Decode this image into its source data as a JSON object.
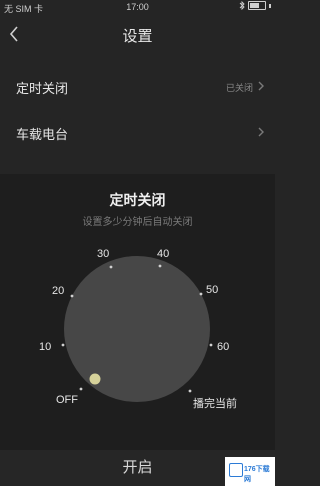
{
  "status_bar": {
    "carrier": "无 SIM 卡",
    "time": "17:00",
    "bluetooth_icon": "bluetooth-icon",
    "battery_icon": "battery-icon"
  },
  "nav": {
    "back_icon": "chevron-left-icon",
    "title": "设置"
  },
  "menu": {
    "items": [
      {
        "label": "定时关闭",
        "value": "已关闭"
      },
      {
        "label": "车载电台",
        "value": ""
      }
    ]
  },
  "sleep_timer": {
    "title": "定时关闭",
    "subtitle": "设置多少分钟后自动关闭",
    "dial_labels": [
      "OFF",
      "10",
      "20",
      "30",
      "40",
      "50",
      "60",
      "播完当前"
    ],
    "selected": "OFF",
    "start_label": "开启"
  },
  "colors": {
    "background": "#252525",
    "dial_fill": "#474747",
    "knob": "#d6d29a",
    "accent_text": "#e8e8e8"
  },
  "watermark": {
    "text": "176下载网"
  }
}
